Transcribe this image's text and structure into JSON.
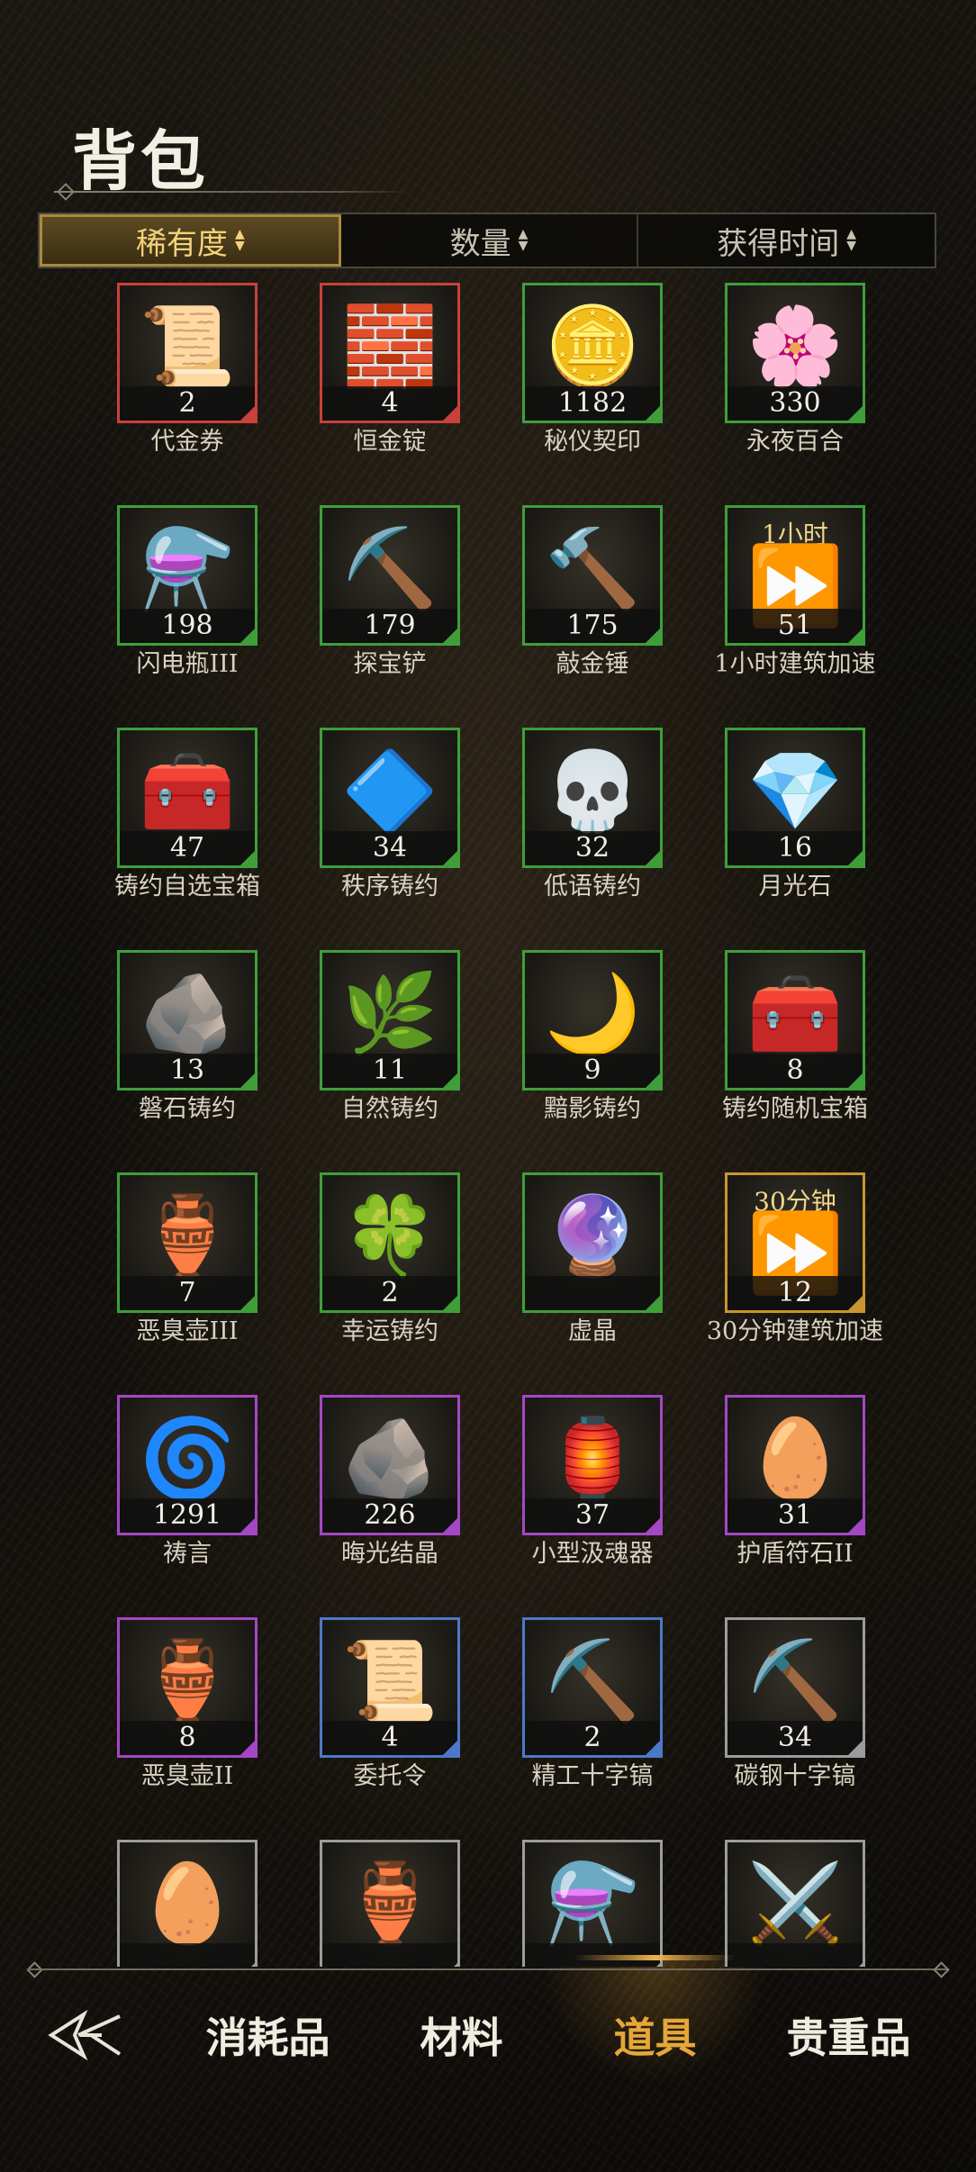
{
  "header": {
    "title": "背包"
  },
  "sort_tabs": [
    {
      "label": "稀有度",
      "active": true
    },
    {
      "label": "数量",
      "active": false
    },
    {
      "label": "获得时间",
      "active": false
    }
  ],
  "items": [
    {
      "name": "代金券",
      "count": "2",
      "rarity": "red",
      "icon": "📜"
    },
    {
      "name": "恒金锭",
      "count": "4",
      "rarity": "red",
      "icon": "🧱"
    },
    {
      "name": "秘仪契印",
      "count": "1182",
      "rarity": "green",
      "icon": "🪙"
    },
    {
      "name": "永夜百合",
      "count": "330",
      "rarity": "green",
      "icon": "🌸"
    },
    {
      "name": "闪电瓶III",
      "count": "198",
      "rarity": "green",
      "icon": "⚗️"
    },
    {
      "name": "探宝铲",
      "count": "179",
      "rarity": "green",
      "icon": "⛏️"
    },
    {
      "name": "敲金锤",
      "count": "175",
      "rarity": "green",
      "icon": "🔨"
    },
    {
      "name": "1小时建筑加速",
      "count": "51",
      "rarity": "green",
      "icon": "⏩",
      "label": "1小时"
    },
    {
      "name": "铸约自选宝箱",
      "count": "47",
      "rarity": "green",
      "icon": "🧰"
    },
    {
      "name": "秩序铸约",
      "count": "34",
      "rarity": "green",
      "icon": "🔷"
    },
    {
      "name": "低语铸约",
      "count": "32",
      "rarity": "green",
      "icon": "💀"
    },
    {
      "name": "月光石",
      "count": "16",
      "rarity": "green",
      "icon": "💎"
    },
    {
      "name": "磐石铸约",
      "count": "13",
      "rarity": "green",
      "icon": "🪨"
    },
    {
      "name": "自然铸约",
      "count": "11",
      "rarity": "green",
      "icon": "🌿"
    },
    {
      "name": "黯影铸约",
      "count": "9",
      "rarity": "green",
      "icon": "🌙"
    },
    {
      "name": "铸约随机宝箱",
      "count": "8",
      "rarity": "green",
      "icon": "🧰"
    },
    {
      "name": "恶臭壶III",
      "count": "7",
      "rarity": "green",
      "icon": "🏺"
    },
    {
      "name": "幸运铸约",
      "count": "2",
      "rarity": "green",
      "icon": "🍀"
    },
    {
      "name": "虚晶",
      "count": "",
      "rarity": "green",
      "icon": "🔮"
    },
    {
      "name": "30分钟建筑加速",
      "count": "12",
      "rarity": "gold",
      "icon": "⏩",
      "label": "30分钟"
    },
    {
      "name": "祷言",
      "count": "1291",
      "rarity": "purple",
      "icon": "🌀"
    },
    {
      "name": "晦光结晶",
      "count": "226",
      "rarity": "purple",
      "icon": "🪨"
    },
    {
      "name": "小型汲魂器",
      "count": "37",
      "rarity": "purple",
      "icon": "🏮"
    },
    {
      "name": "护盾符石II",
      "count": "31",
      "rarity": "purple",
      "icon": "🥚"
    },
    {
      "name": "恶臭壶II",
      "count": "8",
      "rarity": "purple",
      "icon": "🏺"
    },
    {
      "name": "委托令",
      "count": "4",
      "rarity": "blue",
      "icon": "📜"
    },
    {
      "name": "精工十字镐",
      "count": "2",
      "rarity": "blue",
      "icon": "⛏️"
    },
    {
      "name": "碳钢十字镐",
      "count": "34",
      "rarity": "gray",
      "icon": "⛏️"
    },
    {
      "name": "",
      "count": "",
      "rarity": "gray",
      "icon": "🥚"
    },
    {
      "name": "",
      "count": "",
      "rarity": "gray",
      "icon": "🏺"
    },
    {
      "name": "",
      "count": "",
      "rarity": "gray",
      "icon": "⚗️"
    },
    {
      "name": "",
      "count": "",
      "rarity": "gray",
      "icon": "⚔️"
    }
  ],
  "bottom_nav": {
    "back_icon": "back-emblem-icon",
    "tabs": [
      {
        "label": "消耗品",
        "active": false
      },
      {
        "label": "材料",
        "active": false
      },
      {
        "label": "道具",
        "active": true
      },
      {
        "label": "贵重品",
        "active": false
      }
    ]
  },
  "colors": {
    "rarity_red": "#c8413a",
    "rarity_green": "#3f9e3a",
    "rarity_purple": "#a447c4",
    "rarity_blue": "#4d78c9",
    "rarity_gray": "#9c9c9c",
    "rarity_gold": "#c8962e",
    "accent": "#e5a73a"
  }
}
